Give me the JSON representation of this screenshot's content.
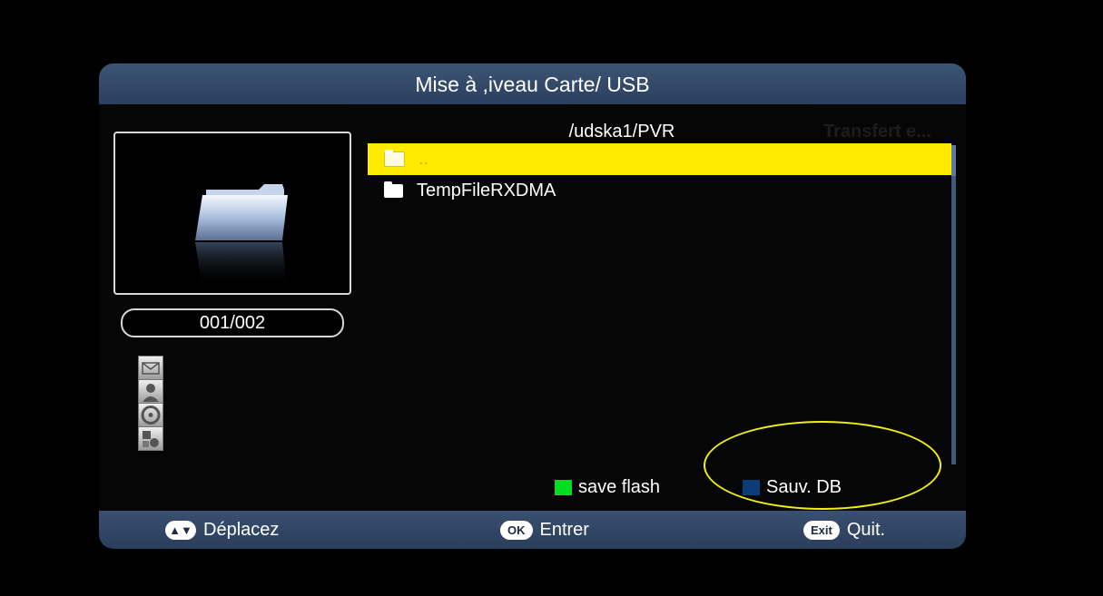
{
  "window": {
    "title": "Mise à ,iveau Carte/ USB"
  },
  "preview": {
    "icon": "folder-icon",
    "counter": "001/002"
  },
  "side_icons": [
    "mail-icon",
    "user-icon",
    "disc-icon",
    "shapes-icon"
  ],
  "browser": {
    "path": "/udska1/PVR",
    "overlay_text": "Transfert e...",
    "items": [
      {
        "label": "..",
        "icon": "folder-icon",
        "selected": true
      },
      {
        "label": "TempFileRXDMA",
        "icon": "folder-icon",
        "selected": false
      }
    ],
    "scroll_position": 0
  },
  "legend": {
    "green": {
      "label": "save flash",
      "color": "#00dd22"
    },
    "blue": {
      "label": "Sauv. DB",
      "color": "#0a3d7a"
    }
  },
  "footer": {
    "move": {
      "key": "▲▼",
      "label": "Déplacez"
    },
    "enter": {
      "key": "OK",
      "label": "Entrer"
    },
    "exit": {
      "key": "Exit",
      "label": "Quit."
    }
  },
  "colors": {
    "title_bar": "#34496a",
    "selection": "#ffea00",
    "annotation": "#f1f10c"
  }
}
